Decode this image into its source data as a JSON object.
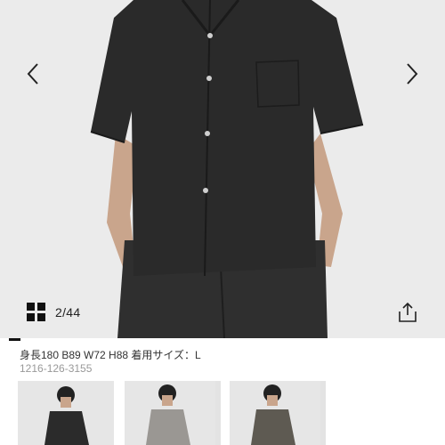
{
  "gallery": {
    "counter": "2/44",
    "prev_icon": "chevron-left-icon",
    "next_icon": "chevron-right-icon",
    "grid_icon": "grid-icon",
    "share_icon": "share-icon",
    "progress_fraction": 0.045
  },
  "product": {
    "model_info": "身長180 B89 W72 H88 着用サイズ：L",
    "code": "1216-126-3155"
  },
  "thumbnails": [
    {
      "color": "#2b2b2b",
      "selected": true
    },
    {
      "color": "#9a9793",
      "selected": false
    },
    {
      "color": "#5e5a52",
      "selected": false
    }
  ],
  "colors": {
    "shirt": "#2a2a2a",
    "pants": "#2f2f2f",
    "skin": "#c9a58c",
    "background": "#e9e9e9"
  }
}
